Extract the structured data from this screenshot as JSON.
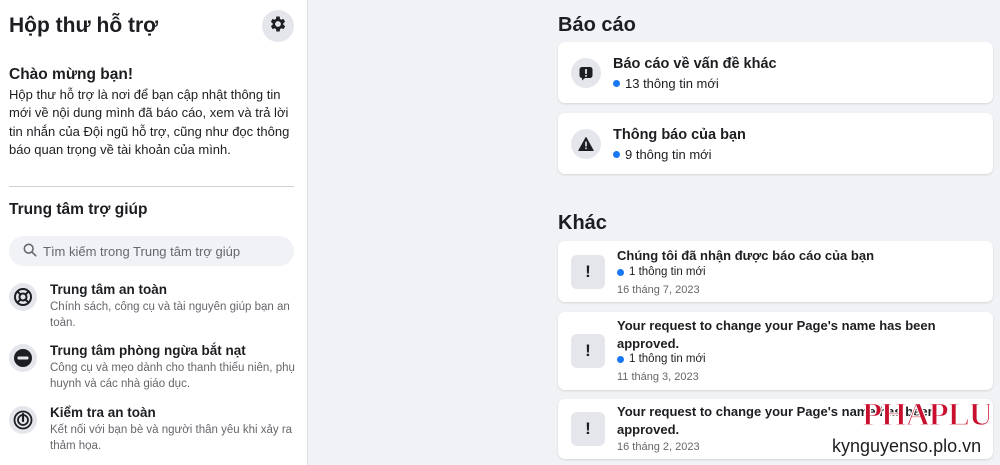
{
  "sidebar": {
    "title": "Hộp thư hỗ trợ",
    "welcome_title": "Chào mừng bạn!",
    "welcome_text": "Hộp thư hỗ trợ là nơi để bạn cập nhật thông tin mới về nội dung mình đã báo cáo, xem và trả lời tin nhắn của Đội ngũ hỗ trợ, cũng như đọc thông báo quan trọng về tài khoản của mình.",
    "help_center_title": "Trung tâm trợ giúp",
    "search_placeholder": "Tìm kiếm trong Trung tâm trợ giúp",
    "items": [
      {
        "title": "Trung tâm an toàn",
        "desc": "Chính sách, công cụ và tài nguyên giúp bạn an toàn.",
        "icon": "lifebuoy-icon"
      },
      {
        "title": "Trung tâm phòng ngừa bắt nạt",
        "desc": "Công cụ và mẹo dành cho thanh thiếu niên, phụ huynh và các nhà giáo dục.",
        "icon": "no-entry-icon"
      },
      {
        "title": "Kiểm tra an toàn",
        "desc": "Kết nối với bạn bè và người thân yêu khi xảy ra thảm họa.",
        "icon": "safety-check-icon"
      }
    ]
  },
  "reports": {
    "title": "Báo cáo",
    "cards": [
      {
        "title": "Báo cáo về vấn đề khác",
        "meta": "13 thông tin mới",
        "icon": "report-icon"
      },
      {
        "title": "Thông báo của bạn",
        "meta": "9 thông tin mới",
        "icon": "warning-icon"
      }
    ]
  },
  "other": {
    "title": "Khác",
    "cards": [
      {
        "title": "Chúng tôi đã nhận được báo cáo của bạn",
        "meta": "1 thông tin mới",
        "date": "16 tháng 7, 2023"
      },
      {
        "title": "Your request to change your Page's name has been approved.",
        "meta": "1 thông tin mới",
        "date": "11 tháng 3, 2023"
      },
      {
        "title": "Your request to change your Page's name has been approved.",
        "date": "16 tháng 2, 2023"
      }
    ]
  },
  "watermark": {
    "logo": "PHAPLUAT",
    "url": "kynguyenso.plo.vn"
  },
  "colors": {
    "accent": "#1877f2",
    "background": "#f0f2f5",
    "logo_red": "#c8102e"
  }
}
